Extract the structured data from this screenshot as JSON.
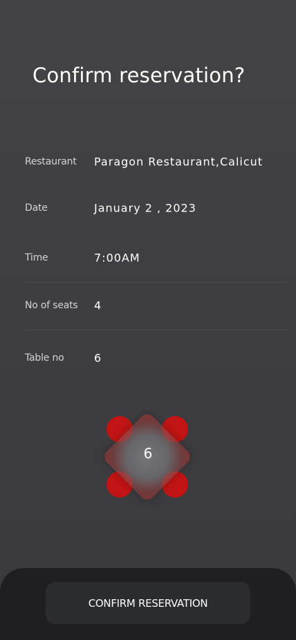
{
  "title": "Confirm reservation?",
  "details": [
    {
      "label": "Restaurant",
      "value": "Paragon Restaurant,Calicut"
    },
    {
      "label": "Date",
      "value": "January 2 , 2023"
    },
    {
      "label": "Time",
      "value": "7:00AM"
    },
    {
      "label": "No of seats",
      "value": "4"
    },
    {
      "label": "Table no",
      "value": "6"
    }
  ],
  "table_graphic": {
    "number": "6",
    "seat_count": 4,
    "seat_color": "#c21414"
  },
  "confirm_button": {
    "label": "CONFIRM RESERVATION"
  },
  "colors": {
    "background": "#434346",
    "bottom_sheet": "#1f1f22",
    "button": "#2b2c30",
    "seat": "#c21414"
  }
}
